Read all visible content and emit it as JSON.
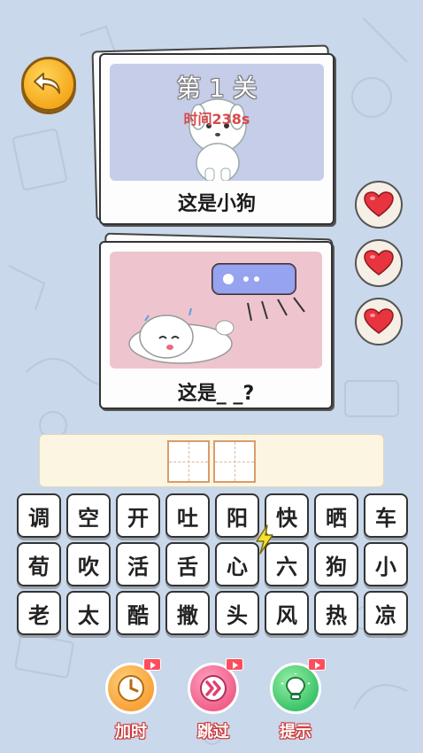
{
  "level": {
    "title": "第 1 关",
    "timer": "时间238s"
  },
  "cards": [
    {
      "caption": "这是小狗"
    },
    {
      "caption": "这是_ _?"
    }
  ],
  "hearts": [
    "heart",
    "heart",
    "heart"
  ],
  "answer": {
    "slots": [
      "",
      ""
    ]
  },
  "chars": [
    [
      "调",
      "空",
      "开",
      "吐",
      "阳",
      "快",
      "晒",
      "车"
    ],
    [
      "荀",
      "吹",
      "活",
      "舌",
      "心",
      "六",
      "狗",
      "小"
    ],
    [
      "老",
      "太",
      "酷",
      "撒",
      "头",
      "风",
      "热",
      "凉"
    ]
  ],
  "actions": [
    {
      "label": "加时",
      "icon": "clock-icon"
    },
    {
      "label": "跳过",
      "icon": "skip-icon"
    },
    {
      "label": "提示",
      "icon": "lightbulb-icon"
    }
  ],
  "colors": {
    "background": "#c9d8ea",
    "back_button": "#f5a81c",
    "card1_bg": "#c5cde8",
    "card2_bg": "#eec5cf",
    "heart": "#e8343e",
    "add_time": "#f7a23a",
    "skip": "#f0608a",
    "hint": "#3cc46a"
  }
}
